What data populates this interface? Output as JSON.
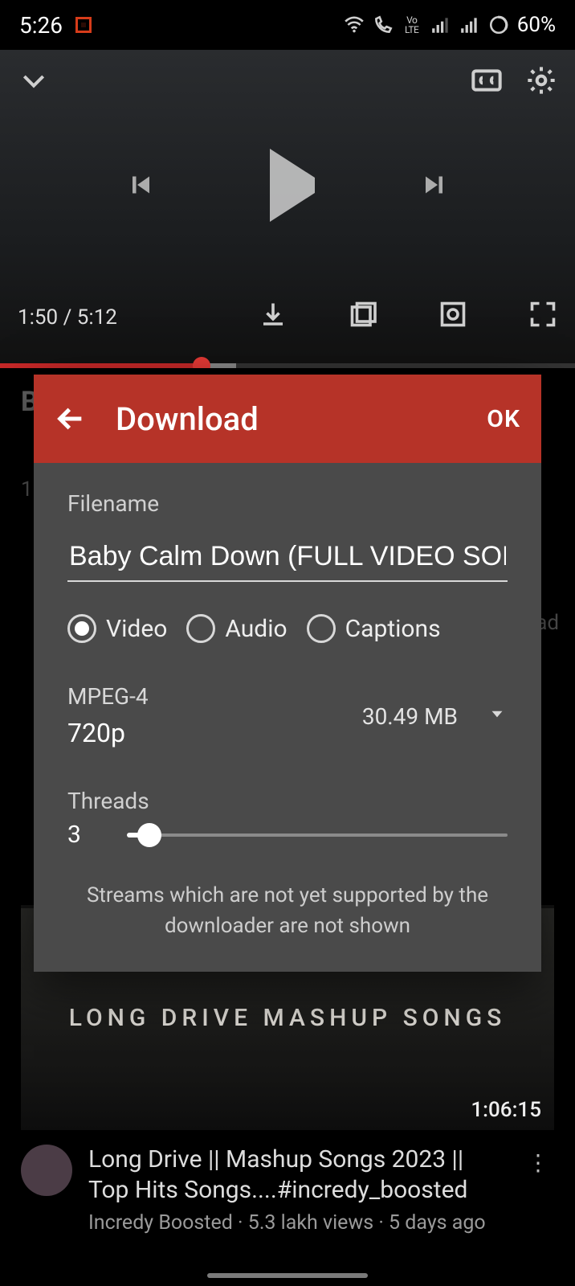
{
  "status": {
    "time": "5:26",
    "battery": "60%"
  },
  "player": {
    "current_time": "1:50",
    "separator": " / ",
    "duration": "5:12"
  },
  "behind": {
    "title_partial": "B",
    "views_partial": "1",
    "ad_label": "ad"
  },
  "dialog": {
    "title": "Download",
    "ok": "OK",
    "filename_label": "Filename",
    "filename_value": "Baby Calm Down (FULL VIDEO SONG)",
    "radios": {
      "video": "Video",
      "audio": "Audio",
      "captions": "Captions"
    },
    "format": {
      "container": "MPEG-4",
      "resolution": "720p",
      "size": "30.49 MB"
    },
    "threads_label": "Threads",
    "threads_value": "3",
    "note": "Streams which are not yet supported by the downloader are not shown"
  },
  "card": {
    "thumb_text": "LONG DRIVE MASHUP SONGS",
    "duration": "1:06:15",
    "title": "Long Drive || Mashup Songs 2023 || Top Hits Songs....#incredy_boosted",
    "subtitle": "Incredy Boosted  · 5.3 lakh views · 5 days ago"
  }
}
